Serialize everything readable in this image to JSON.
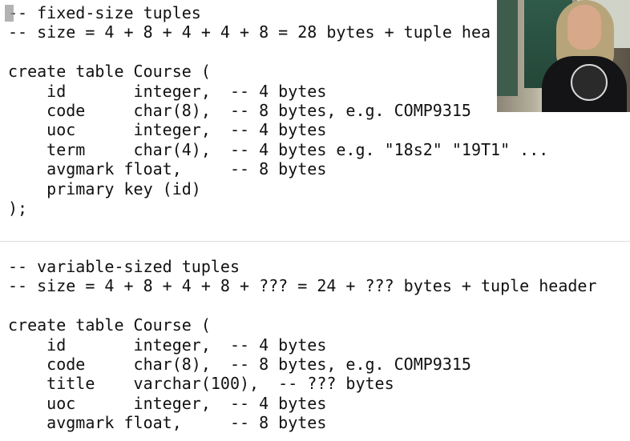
{
  "code_lines": [
    "-- fixed-size tuples",
    "-- size = 4 + 8 + 4 + 4 + 8 = 28 bytes + tuple hea",
    "",
    "create table Course (",
    "    id       integer,  -- 4 bytes",
    "    code     char(8),  -- 8 bytes, e.g. COMP9315",
    "    uoc      integer,  -- 4 bytes",
    "    term     char(4),  -- 4 bytes e.g. \"18s2\" \"19T1\" ...",
    "    avgmark float,     -- 8 bytes",
    "    primary key (id)",
    ");",
    "",
    "",
    "-- variable-sized tuples",
    "-- size = 4 + 8 + 4 + 8 + ??? = 24 + ??? bytes + tuple header",
    "",
    "create table Course (",
    "    id       integer,  -- 4 bytes",
    "    code     char(8),  -- 8 bytes, e.g. COMP9315",
    "    title    varchar(100),  -- ??? bytes",
    "    uoc      integer,  -- 4 bytes",
    "    avgmark float,     -- 8 bytes"
  ],
  "colors": {
    "background": "#ffffff",
    "text": "#111111",
    "cursor": "#9a9a9a"
  }
}
